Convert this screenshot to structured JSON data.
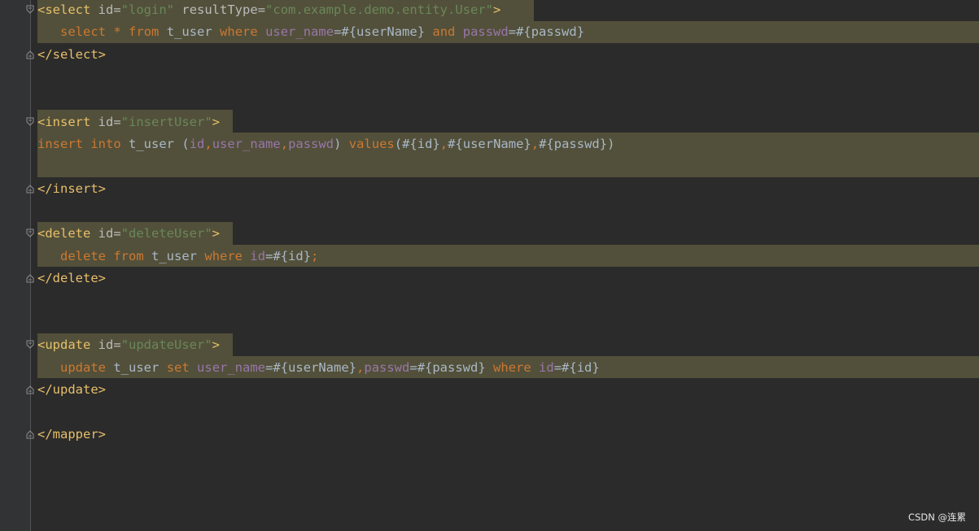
{
  "blocks": {
    "select_open": {
      "tag": "<select",
      "attr1": "id",
      "eq1": "=",
      "val1": "\"login\"",
      "attr2": "resultType",
      "eq2": "=",
      "val2": "\"com.example.demo.entity.User\"",
      "close": ">"
    },
    "select_body": {
      "kw1": "select",
      "star": "*",
      "kw2": "from",
      "table": "t_user",
      "kw3": "where",
      "col1": "user_name",
      "p1": "=#{userName}",
      "kw4": "and",
      "col2": "passwd",
      "p2": "=#{passwd}"
    },
    "select_close": "</select>",
    "insert_open": {
      "tag": "<insert",
      "attr": "id",
      "eq": "=",
      "val": "\"insertUser\"",
      "close": ">"
    },
    "insert_body": {
      "kw1": "insert",
      "kw2": "into",
      "table": "t_user",
      "paren_open": "(",
      "col1": "id",
      "comma1": ",",
      "col2": "user_name",
      "comma2": ",",
      "col3": "passwd",
      "paren_close": ")",
      "kw3": "values",
      "v_open": "(#{id}",
      "comma3": ",",
      "v2": "#{userName}",
      "comma4": ",",
      "v3": "#{passwd})"
    },
    "insert_close": "</insert>",
    "delete_open": {
      "tag": "<delete",
      "attr": "id",
      "eq": "=",
      "val": "\"deleteUser\"",
      "close": ">"
    },
    "delete_body": {
      "kw1": "delete",
      "kw2": "from",
      "table": "t_user",
      "kw3": "where",
      "col1": "id",
      "p1": "=#{id}",
      "semi": ";"
    },
    "delete_close": "</delete>",
    "update_open": {
      "tag": "<update",
      "attr": "id",
      "eq": "=",
      "val": "\"updateUser\"",
      "close": ">"
    },
    "update_body": {
      "kw1": "update",
      "table": "t_user",
      "kw2": "set",
      "col1": "user_name",
      "p1": "=#{userName}",
      "comma1": ",",
      "col2": "passwd",
      "p2": "=#{passwd}",
      "kw3": "where",
      "col3": "id",
      "p3": "=#{id}"
    },
    "update_close": "</update>",
    "mapper_close": "</mapper>"
  },
  "watermark": "CSDN @连累",
  "colors": {
    "background": "#2b2b2b",
    "highlight": "#52503a",
    "tag": "#e8bf6a",
    "keyword": "#cc7832",
    "column": "#9876aa",
    "string": "#6a8759",
    "text": "#a9b7c6"
  }
}
